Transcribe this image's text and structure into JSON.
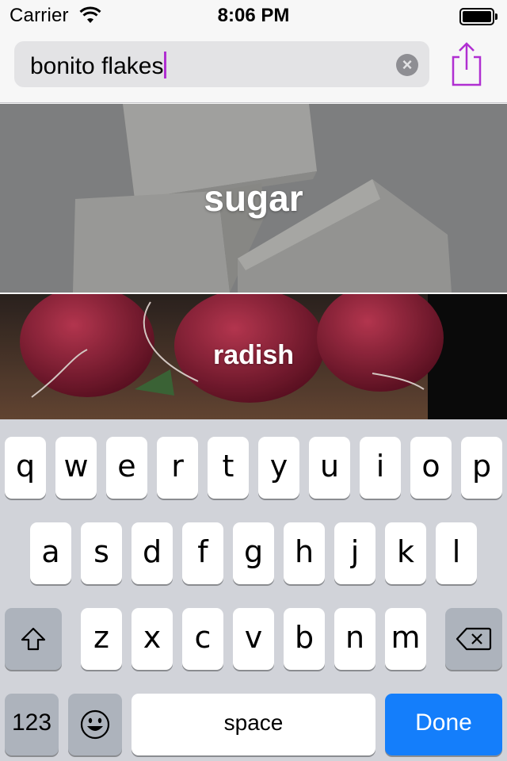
{
  "status": {
    "carrier": "Carrier",
    "time": "8:06 PM"
  },
  "search": {
    "value": "bonito flakes",
    "clear_glyph": "×"
  },
  "share": {
    "icon": "share-icon"
  },
  "results": [
    {
      "label": "sugar"
    },
    {
      "label": "radish"
    }
  ],
  "keyboard": {
    "row1": [
      "q",
      "w",
      "e",
      "r",
      "t",
      "y",
      "u",
      "i",
      "o",
      "p"
    ],
    "row2": [
      "a",
      "s",
      "d",
      "f",
      "g",
      "h",
      "j",
      "k",
      "l"
    ],
    "row3": [
      "z",
      "x",
      "c",
      "v",
      "b",
      "n",
      "m"
    ],
    "numbers_label": "123",
    "emoji_label": "😀",
    "space_label": "space",
    "done_label": "Done"
  },
  "colors": {
    "accent": "#b02fd1",
    "done": "#147efb"
  }
}
